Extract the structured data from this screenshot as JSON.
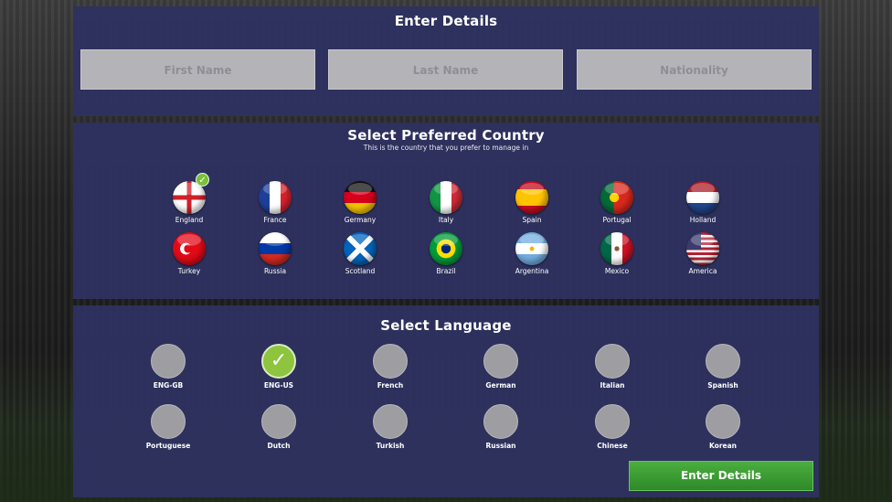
{
  "details": {
    "title": "Enter Details",
    "first_name_placeholder": "First Name",
    "last_name_placeholder": "Last Name",
    "nationality_placeholder": "Nationality"
  },
  "country": {
    "title": "Select Preferred Country",
    "subtitle": "This is the country that you prefer to manage in",
    "selected": "England",
    "items": [
      {
        "label": "England"
      },
      {
        "label": "France"
      },
      {
        "label": "Germany"
      },
      {
        "label": "Italy"
      },
      {
        "label": "Spain"
      },
      {
        "label": "Portugal"
      },
      {
        "label": "Holland"
      },
      {
        "label": "Turkey"
      },
      {
        "label": "Russia"
      },
      {
        "label": "Scotland"
      },
      {
        "label": "Brazil"
      },
      {
        "label": "Argentina"
      },
      {
        "label": "Mexico"
      },
      {
        "label": "America"
      }
    ]
  },
  "language": {
    "title": "Select Language",
    "selected": "ENG-US",
    "items": [
      {
        "label": "ENG-GB"
      },
      {
        "label": "ENG-US"
      },
      {
        "label": "French"
      },
      {
        "label": "German"
      },
      {
        "label": "Italian"
      },
      {
        "label": "Spanish"
      },
      {
        "label": "Portuguese"
      },
      {
        "label": "Dutch"
      },
      {
        "label": "Turkish"
      },
      {
        "label": "Russian"
      },
      {
        "label": "Chinese"
      },
      {
        "label": "Korean"
      }
    ]
  },
  "submit_label": "Enter Details",
  "colors": {
    "panel": "#2e3260",
    "input_bg": "#b3b3b8",
    "check_green": "#7cbf3a",
    "button_green": "#3c9c34"
  }
}
